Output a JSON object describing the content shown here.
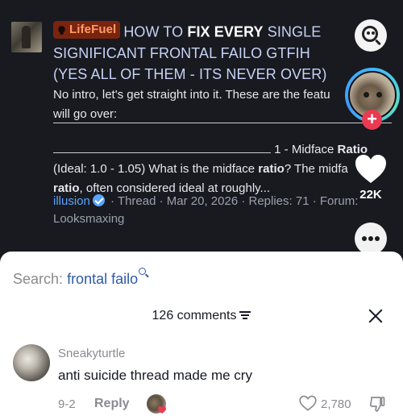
{
  "video": {
    "post_prefix": "LifeFuel",
    "title_parts": {
      "p1": "HOW TO ",
      "h1": "FIX EVERY",
      "p2": " SINGLE SIGNIFICANT FRONTAL FAILO GTFIH (YES ALL OF THEM - ITS NEVER OVER)"
    },
    "excerpt_line1": "No intro, let's get straight into it. These are the featu",
    "excerpt_line2": "will go over:",
    "section_intro": "1 - Midface",
    "section_bold": "Ratio",
    "excerpt_line3_a": "(Ideal: 1.0 - 1.05) What is the midface ",
    "excerpt_line3_b": "ratio",
    "excerpt_line3_c": "? The midfa",
    "excerpt_line4_a": "ratio",
    "excerpt_line4_b": ", often considered ideal at roughly...",
    "author": "illusion",
    "meta": "· Thread · Mar 20, 2026 · Replies: 71 · Forum:",
    "forum": "Looksmaxing",
    "like_count": "22K",
    "follow_label": "+"
  },
  "sheet": {
    "search_label": "Search:",
    "search_query": "frontal failo",
    "comments_count_label": "126 comments",
    "comment": {
      "username": "Sneakyturtle",
      "text": "anti suicide thread made me cry",
      "date": "9-2",
      "reply_label": "Reply",
      "like_count": "2,780"
    }
  },
  "colors": {
    "accent_link": "#5aa4ff",
    "badge_bg": "#7a2410",
    "follow_red": "#ea3a52",
    "search_blue": "#2e5aa8"
  },
  "icons": [
    "bulb-icon",
    "search-face-icon",
    "follow-plus-icon",
    "heart-icon",
    "more-icon",
    "verified-icon",
    "sort-icon",
    "close-icon",
    "dislike-icon"
  ]
}
